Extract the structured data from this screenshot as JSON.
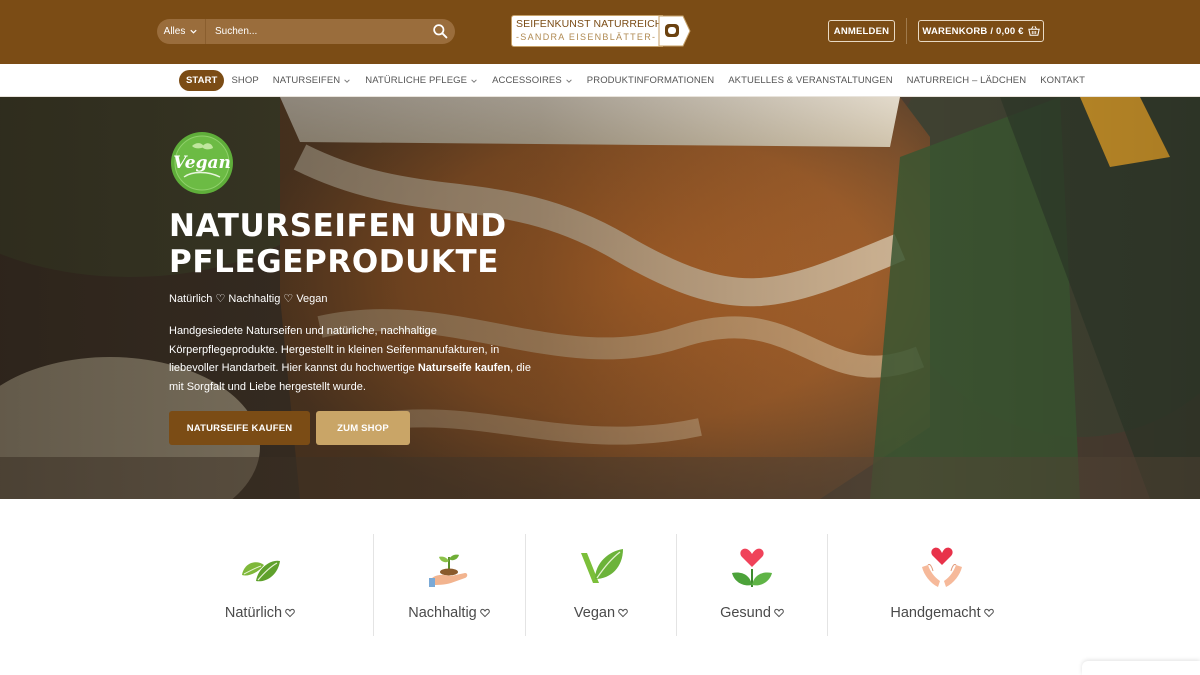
{
  "header": {
    "search": {
      "category": "Alles",
      "placeholder": "Suchen..."
    },
    "logo": {
      "line1": "SEIFENKUNST NATURREICH",
      "line2": "-SANDRA EISENBLÄTTER-"
    },
    "login_label": "ANMELDEN",
    "cart_label": "WARENKORB / 0,00 €"
  },
  "nav": {
    "items": [
      {
        "label": "START",
        "active": true,
        "dropdown": false
      },
      {
        "label": "SHOP",
        "active": false,
        "dropdown": false
      },
      {
        "label": "NATURSEIFEN",
        "active": false,
        "dropdown": true
      },
      {
        "label": "NATÜRLICHE PFLEGE",
        "active": false,
        "dropdown": true
      },
      {
        "label": "ACCESSOIRES",
        "active": false,
        "dropdown": true
      },
      {
        "label": "PRODUKTINFORMATIONEN",
        "active": false,
        "dropdown": false
      },
      {
        "label": "AKTUELLES & VERANSTALTUNGEN",
        "active": false,
        "dropdown": false
      },
      {
        "label": "NATURREICH – LÄDCHEN",
        "active": false,
        "dropdown": false
      },
      {
        "label": "KONTAKT",
        "active": false,
        "dropdown": false
      }
    ]
  },
  "hero": {
    "badge_text": "Vegan",
    "title_line1": "NATURSEIFEN UND",
    "title_line2": "PFLEGEPRODUKTE",
    "tagline": "Natürlich ♡ Nachhaltig ♡ Vegan",
    "text_before": "Handgesiedete Naturseifen und natürliche, nachhaltige Körperpflegeprodukte. Hergestellt in kleinen Seifenmanufakturen, in liebevoller Handarbeit. Hier kannst du hochwertige ",
    "text_bold": "Naturseife kaufen",
    "text_after": ", die mit Sorgfalt und Liebe hergestellt wurde.",
    "primary_button": "NATURSEIFE KAUFEN",
    "secondary_button": "ZUM SHOP"
  },
  "features": [
    {
      "label": "Natürlich",
      "icon": "leaves-icon"
    },
    {
      "label": "Nachhaltig",
      "icon": "seedling-hand-icon"
    },
    {
      "label": "Vegan",
      "icon": "vegan-leaf-icon"
    },
    {
      "label": "Gesund",
      "icon": "heart-leaves-icon"
    },
    {
      "label": "Handgemacht",
      "icon": "heart-hands-icon"
    }
  ],
  "colors": {
    "brand_brown": "#7b4c15",
    "accent_gold": "#c9a567",
    "vegan_green": "#5fae3a"
  }
}
